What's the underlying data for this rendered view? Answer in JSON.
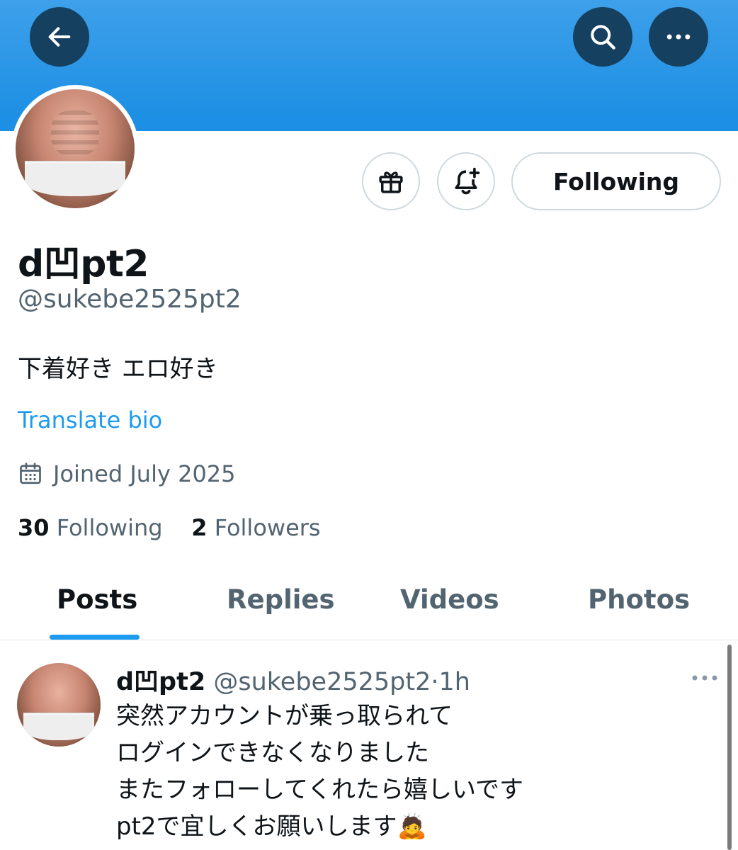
{
  "colors": {
    "banner": "#1d8fe4",
    "accent": "#1d9bf0",
    "text_primary": "#0f1419",
    "text_secondary": "#536471",
    "header_button": "#15405f"
  },
  "header": {
    "back_icon": "arrow-left-icon",
    "search_icon": "search-icon",
    "more_icon": "more-horizontal-icon"
  },
  "profile": {
    "display_name": "d凹pt2",
    "handle": "@sukebe2525pt2",
    "bio": "下着好き エロ好き",
    "translate_label": "Translate bio",
    "joined": "Joined July 2025",
    "following_count": "30",
    "following_label": "Following",
    "followers_count": "2",
    "followers_label": "Followers"
  },
  "actions": {
    "gift_icon": "gift-icon",
    "notify_icon": "bell-plus-icon",
    "follow_state_label": "Following"
  },
  "tabs": [
    {
      "label": "Posts",
      "active": true
    },
    {
      "label": "Replies",
      "active": false
    },
    {
      "label": "Videos",
      "active": false
    },
    {
      "label": "Photos",
      "active": false
    }
  ],
  "post": {
    "name": "d凹pt2",
    "handle": "@sukebe2525pt2",
    "separator": "·",
    "time": "1h",
    "lines": [
      "突然アカウントが乗っ取られて",
      "ログインできなくなりました",
      "またフォローしてくれたら嬉しいです",
      "pt2で宜しくお願いします🙇"
    ]
  }
}
